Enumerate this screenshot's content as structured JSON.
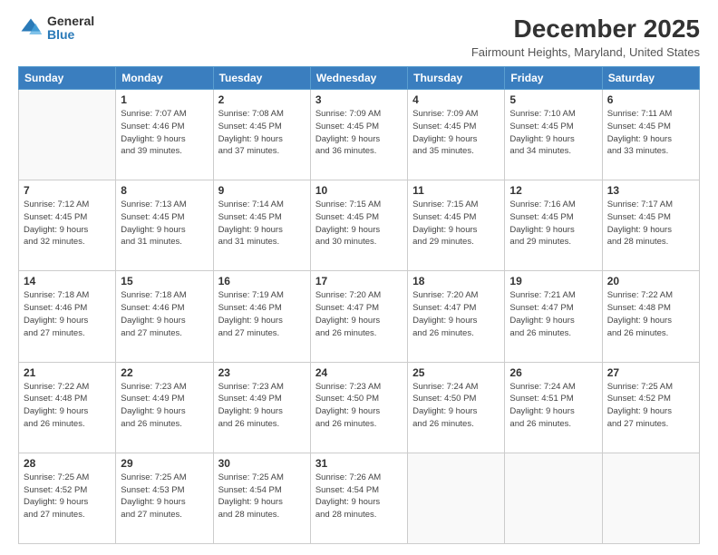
{
  "logo": {
    "general": "General",
    "blue": "Blue"
  },
  "title": "December 2025",
  "subtitle": "Fairmount Heights, Maryland, United States",
  "days_header": [
    "Sunday",
    "Monday",
    "Tuesday",
    "Wednesday",
    "Thursday",
    "Friday",
    "Saturday"
  ],
  "weeks": [
    [
      {
        "day": "",
        "info": ""
      },
      {
        "day": "1",
        "info": "Sunrise: 7:07 AM\nSunset: 4:46 PM\nDaylight: 9 hours\nand 39 minutes."
      },
      {
        "day": "2",
        "info": "Sunrise: 7:08 AM\nSunset: 4:45 PM\nDaylight: 9 hours\nand 37 minutes."
      },
      {
        "day": "3",
        "info": "Sunrise: 7:09 AM\nSunset: 4:45 PM\nDaylight: 9 hours\nand 36 minutes."
      },
      {
        "day": "4",
        "info": "Sunrise: 7:09 AM\nSunset: 4:45 PM\nDaylight: 9 hours\nand 35 minutes."
      },
      {
        "day": "5",
        "info": "Sunrise: 7:10 AM\nSunset: 4:45 PM\nDaylight: 9 hours\nand 34 minutes."
      },
      {
        "day": "6",
        "info": "Sunrise: 7:11 AM\nSunset: 4:45 PM\nDaylight: 9 hours\nand 33 minutes."
      }
    ],
    [
      {
        "day": "7",
        "info": "Sunrise: 7:12 AM\nSunset: 4:45 PM\nDaylight: 9 hours\nand 32 minutes."
      },
      {
        "day": "8",
        "info": "Sunrise: 7:13 AM\nSunset: 4:45 PM\nDaylight: 9 hours\nand 31 minutes."
      },
      {
        "day": "9",
        "info": "Sunrise: 7:14 AM\nSunset: 4:45 PM\nDaylight: 9 hours\nand 31 minutes."
      },
      {
        "day": "10",
        "info": "Sunrise: 7:15 AM\nSunset: 4:45 PM\nDaylight: 9 hours\nand 30 minutes."
      },
      {
        "day": "11",
        "info": "Sunrise: 7:15 AM\nSunset: 4:45 PM\nDaylight: 9 hours\nand 29 minutes."
      },
      {
        "day": "12",
        "info": "Sunrise: 7:16 AM\nSunset: 4:45 PM\nDaylight: 9 hours\nand 29 minutes."
      },
      {
        "day": "13",
        "info": "Sunrise: 7:17 AM\nSunset: 4:45 PM\nDaylight: 9 hours\nand 28 minutes."
      }
    ],
    [
      {
        "day": "14",
        "info": "Sunrise: 7:18 AM\nSunset: 4:46 PM\nDaylight: 9 hours\nand 27 minutes."
      },
      {
        "day": "15",
        "info": "Sunrise: 7:18 AM\nSunset: 4:46 PM\nDaylight: 9 hours\nand 27 minutes."
      },
      {
        "day": "16",
        "info": "Sunrise: 7:19 AM\nSunset: 4:46 PM\nDaylight: 9 hours\nand 27 minutes."
      },
      {
        "day": "17",
        "info": "Sunrise: 7:20 AM\nSunset: 4:47 PM\nDaylight: 9 hours\nand 26 minutes."
      },
      {
        "day": "18",
        "info": "Sunrise: 7:20 AM\nSunset: 4:47 PM\nDaylight: 9 hours\nand 26 minutes."
      },
      {
        "day": "19",
        "info": "Sunrise: 7:21 AM\nSunset: 4:47 PM\nDaylight: 9 hours\nand 26 minutes."
      },
      {
        "day": "20",
        "info": "Sunrise: 7:22 AM\nSunset: 4:48 PM\nDaylight: 9 hours\nand 26 minutes."
      }
    ],
    [
      {
        "day": "21",
        "info": "Sunrise: 7:22 AM\nSunset: 4:48 PM\nDaylight: 9 hours\nand 26 minutes."
      },
      {
        "day": "22",
        "info": "Sunrise: 7:23 AM\nSunset: 4:49 PM\nDaylight: 9 hours\nand 26 minutes."
      },
      {
        "day": "23",
        "info": "Sunrise: 7:23 AM\nSunset: 4:49 PM\nDaylight: 9 hours\nand 26 minutes."
      },
      {
        "day": "24",
        "info": "Sunrise: 7:23 AM\nSunset: 4:50 PM\nDaylight: 9 hours\nand 26 minutes."
      },
      {
        "day": "25",
        "info": "Sunrise: 7:24 AM\nSunset: 4:50 PM\nDaylight: 9 hours\nand 26 minutes."
      },
      {
        "day": "26",
        "info": "Sunrise: 7:24 AM\nSunset: 4:51 PM\nDaylight: 9 hours\nand 26 minutes."
      },
      {
        "day": "27",
        "info": "Sunrise: 7:25 AM\nSunset: 4:52 PM\nDaylight: 9 hours\nand 27 minutes."
      }
    ],
    [
      {
        "day": "28",
        "info": "Sunrise: 7:25 AM\nSunset: 4:52 PM\nDaylight: 9 hours\nand 27 minutes."
      },
      {
        "day": "29",
        "info": "Sunrise: 7:25 AM\nSunset: 4:53 PM\nDaylight: 9 hours\nand 27 minutes."
      },
      {
        "day": "30",
        "info": "Sunrise: 7:25 AM\nSunset: 4:54 PM\nDaylight: 9 hours\nand 28 minutes."
      },
      {
        "day": "31",
        "info": "Sunrise: 7:26 AM\nSunset: 4:54 PM\nDaylight: 9 hours\nand 28 minutes."
      },
      {
        "day": "",
        "info": ""
      },
      {
        "day": "",
        "info": ""
      },
      {
        "day": "",
        "info": ""
      }
    ]
  ]
}
